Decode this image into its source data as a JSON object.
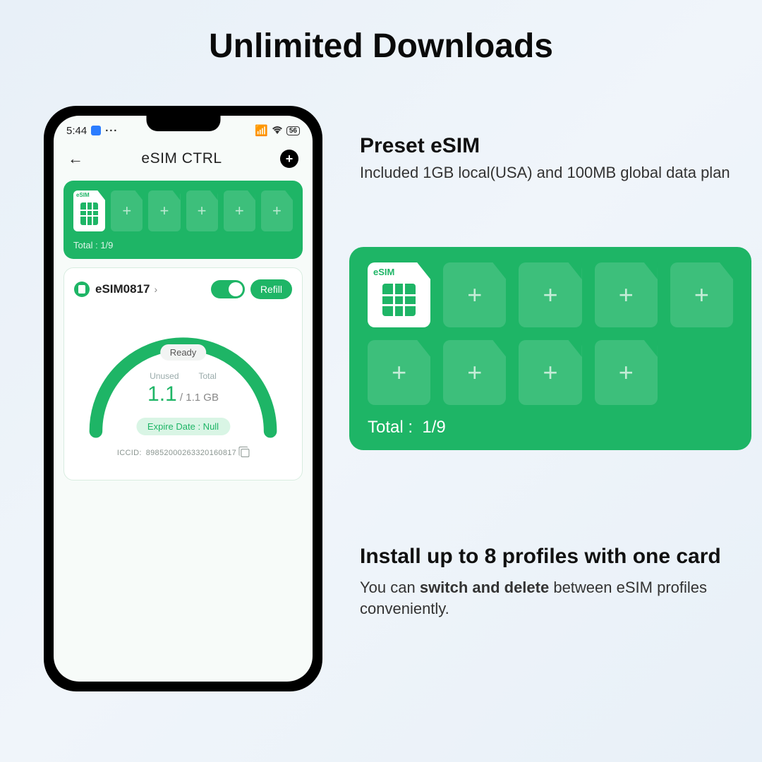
{
  "page_title": "Unlimited Downloads",
  "phone": {
    "status": {
      "time": "5:44",
      "battery": "56"
    },
    "app_header": {
      "title": "eSIM CTRL"
    },
    "tray": {
      "esim_label": "eSIM",
      "total_label": "Total :",
      "total_value": "1/9"
    },
    "detail": {
      "name": "eSIM0817",
      "refill": "Refill",
      "ready": "Ready",
      "unused_label": "Unused",
      "total_label": "Total",
      "unused_value": "1.1",
      "total_value": "/ 1.1 GB",
      "expire": "Expire Date : Null",
      "iccid_label": "ICCID:",
      "iccid_value": "89852000263320160817"
    }
  },
  "preset": {
    "title": "Preset eSIM",
    "body": "Included 1GB local(USA) and 100MB global data plan"
  },
  "big_card": {
    "esim_label": "eSIM",
    "total_label": "Total :",
    "total_value": "1/9"
  },
  "profiles": {
    "title": "Install up to 8 profiles with one card",
    "body_prefix": "You can ",
    "body_bold": "switch and delete",
    "body_suffix": " between eSIM profiles conveniently."
  }
}
